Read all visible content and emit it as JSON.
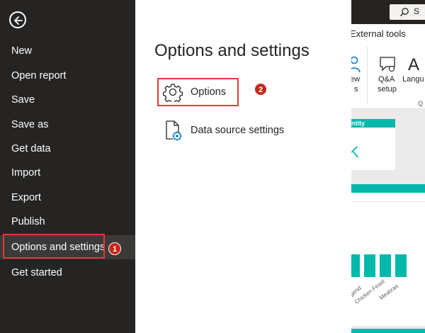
{
  "backstage": {
    "nav_items": [
      {
        "label": "New"
      },
      {
        "label": "Open report"
      },
      {
        "label": "Save"
      },
      {
        "label": "Save as"
      },
      {
        "label": "Get data"
      },
      {
        "label": "Import"
      },
      {
        "label": "Export"
      },
      {
        "label": "Publish"
      },
      {
        "label": "Options and settings",
        "selected": true
      },
      {
        "label": "Get started"
      }
    ],
    "icons": {
      "back": "back-arrow-icon"
    }
  },
  "panel": {
    "title": "Options and settings",
    "items": [
      {
        "label": "Options",
        "icon": "gear-icon"
      },
      {
        "label": "Data source settings",
        "icon": "document-gear-icon"
      }
    ]
  },
  "annotations": {
    "step1": "1",
    "step2": "2",
    "highlight_color": "#e2393b",
    "badge_color": "#c4281d"
  },
  "background_app": {
    "search_label": "S",
    "ribbon_tab": "External tools",
    "ribbon_labels": {
      "new_visual_partial": "ew",
      "new_visual_partial_2": "s",
      "qa_line1": "Q&A",
      "qa_line2": "setup",
      "language_partial": "Langu",
      "group_partial": "Q"
    },
    "card_title_partial": "ntity",
    "card_glyph": "K",
    "chart_axis_labels": [
      "gend",
      "Chicken Feast",
      "Meatzaa"
    ],
    "chart_values": [
      0.9,
      0.9,
      0.9,
      0.9
    ],
    "colors": {
      "accent": "#01b8aa",
      "nav_bg": "#252423",
      "nav_active": "#3b3a39"
    }
  }
}
